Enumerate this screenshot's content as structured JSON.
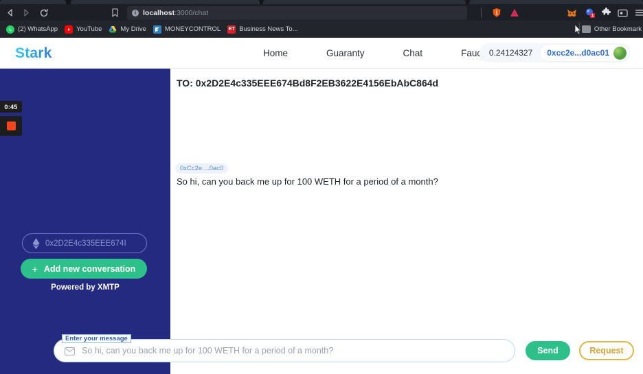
{
  "browser": {
    "nav": {
      "back": "back-arrow",
      "forward": "forward-arrow",
      "reload": "reload-arrow"
    },
    "url_host": "localhost",
    "url_path": ":3000/chat",
    "url_full": "localhost:3000/chat",
    "bookmarks": [
      {
        "label": "(2) WhatsApp",
        "icon": "whatsapp-icon",
        "glyph": ""
      },
      {
        "label": "YouTube",
        "icon": "youtube-icon",
        "glyph": "▶"
      },
      {
        "label": "My Drive",
        "icon": "google-drive-icon",
        "glyph": ""
      },
      {
        "label": "MONEYCONTROL",
        "icon": "moneycontrol-icon",
        "glyph": "✔"
      },
      {
        "label": "Business News To...",
        "icon": "economic-times-icon",
        "glyph": "ET"
      }
    ],
    "other_bookmarks": "Other Bookmark",
    "toolbar_icons": [
      {
        "name": "brave-shields-icon"
      },
      {
        "name": "warning-triangle-icon"
      },
      {
        "name": "metamask-extension-icon"
      },
      {
        "name": "wallet-extension-icon"
      },
      {
        "name": "extensions-puzzle-icon"
      },
      {
        "name": "profile-card-icon"
      },
      {
        "name": "browser-menu-icon"
      }
    ]
  },
  "recording": {
    "time": "0:45",
    "stop_label": "stop-recording"
  },
  "header": {
    "logo": "Stark",
    "nav": [
      {
        "label": "Home",
        "name": "nav-home"
      },
      {
        "label": "Guaranty",
        "name": "nav-guaranty"
      },
      {
        "label": "Chat",
        "name": "nav-chat"
      },
      {
        "label": "Faucet",
        "name": "nav-faucet"
      }
    ],
    "wallet": {
      "balance": "0.24124327",
      "address": "0xcc2e...d0ac01"
    }
  },
  "sidebar": {
    "address_placeholder": "0x2D2E4c335EEE674I",
    "add_conversation": "Add new conversation",
    "add_icon": "plus-icon",
    "powered_by": "Powered by XMTP"
  },
  "chat": {
    "to_line": "TO: 0x2D2E4c335EEE674Bd8F2EB3622E4156EbAbC864d",
    "messages": [
      {
        "sender": "0xCc2e....0ac0",
        "text": "So hi, can you back me up for 100 WETH for a period of a month?"
      }
    ]
  },
  "composer": {
    "label": "Enter your message",
    "placeholder": "So hi, can you back me up for 100 WETH for a period of a month?",
    "icon": "envelope-icon",
    "send_label": "Send",
    "request_label": "Request"
  },
  "colors": {
    "sidebar_navy": "#232a7f",
    "accent_green": "#2dc08a",
    "accent_gold": "#d2a438",
    "logo_blue": "#2b7fd4",
    "badge_blue": "#5b87d8"
  }
}
